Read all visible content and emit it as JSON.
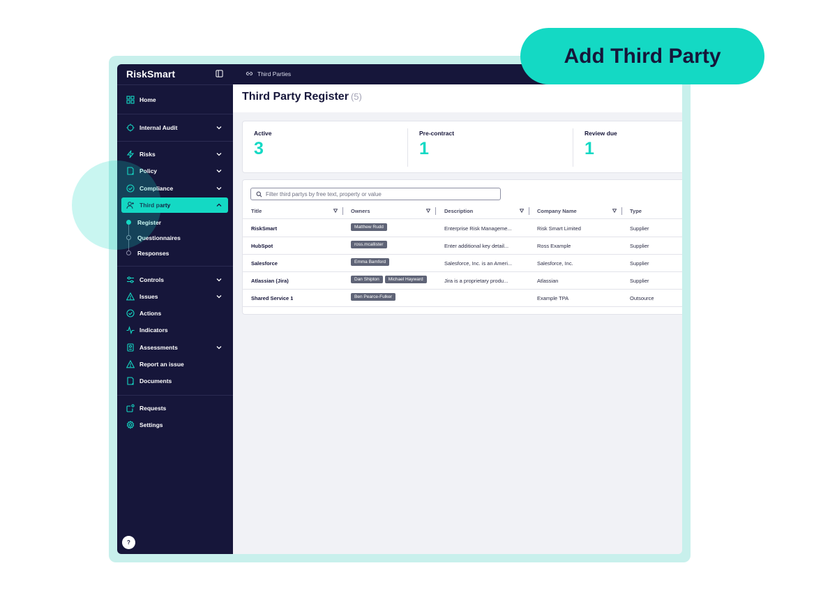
{
  "app": {
    "brand": "RiskSmart"
  },
  "topbar": {
    "breadcrumb": "Third Parties"
  },
  "callout": {
    "label": "Add Third Party"
  },
  "sidebar": {
    "items": [
      {
        "label": "Home",
        "icon": "home-grid-icon"
      },
      {
        "label": "Internal Audit",
        "icon": "audit-icon",
        "expandable": true
      },
      {
        "label": "Risks",
        "icon": "lightning-icon",
        "expandable": true
      },
      {
        "label": "Policy",
        "icon": "document-icon",
        "expandable": true
      },
      {
        "label": "Compliance",
        "icon": "check-circle-icon",
        "expandable": true
      },
      {
        "label": "Third party",
        "icon": "add-user-icon",
        "expandable": true,
        "active": true
      },
      {
        "label": "Controls",
        "icon": "sliders-icon",
        "expandable": true
      },
      {
        "label": "Issues",
        "icon": "warning-icon",
        "expandable": true
      },
      {
        "label": "Actions",
        "icon": "check-circle-icon"
      },
      {
        "label": "Indicators",
        "icon": "pulse-icon"
      },
      {
        "label": "Assessments",
        "icon": "assessment-icon",
        "expandable": true
      },
      {
        "label": "Report an issue",
        "icon": "warning-icon"
      },
      {
        "label": "Documents",
        "icon": "document-icon"
      },
      {
        "label": "Requests",
        "icon": "request-icon"
      },
      {
        "label": "Settings",
        "icon": "gear-icon"
      }
    ],
    "sub_items": [
      {
        "label": "Register",
        "selected": true
      },
      {
        "label": "Questionnaires"
      },
      {
        "label": "Responses"
      }
    ],
    "help": "?"
  },
  "main": {
    "title": "Third Party Register",
    "count": "(5)",
    "stats": [
      {
        "label": "Active",
        "value": "3"
      },
      {
        "label": "Pre-contract",
        "value": "1"
      },
      {
        "label": "Review due",
        "value": "1"
      }
    ],
    "search_placeholder": "Filter third partys by free text, property or value",
    "columns": [
      "Title",
      "Owners",
      "Description",
      "Company Name",
      "Type"
    ],
    "rows": [
      {
        "title": "RiskSmart",
        "owners": [
          "Matthew Rudd"
        ],
        "description": "Enterprise Risk Manageme...",
        "company": "Risk Smart Limited",
        "type": "Supplier"
      },
      {
        "title": "HubSpot",
        "owners": [
          "ross.mcallister"
        ],
        "description": "Enter additional key detail...",
        "company": "Ross Example",
        "type": "Supplier"
      },
      {
        "title": "Salesforce",
        "owners": [
          "Emma Bamford"
        ],
        "description": "Salesforce, Inc. is an Ameri...",
        "company": "Salesforce, Inc.",
        "type": "Supplier"
      },
      {
        "title": "Atlassian (Jira)",
        "owners": [
          "Dan Shipton",
          "Michael Hayward"
        ],
        "description": "Jira is a proprietary produ...",
        "company": "Atlassian",
        "type": "Supplier"
      },
      {
        "title": "Shared Service 1",
        "owners": [
          "Ben Pearce-Fulker"
        ],
        "description": "",
        "company": "Example TPA",
        "type": "Outsource"
      }
    ]
  },
  "colors": {
    "navy": "#16163a",
    "accent": "#14d9c4",
    "frame": "#c8f0ec",
    "chip": "#5f6477"
  }
}
